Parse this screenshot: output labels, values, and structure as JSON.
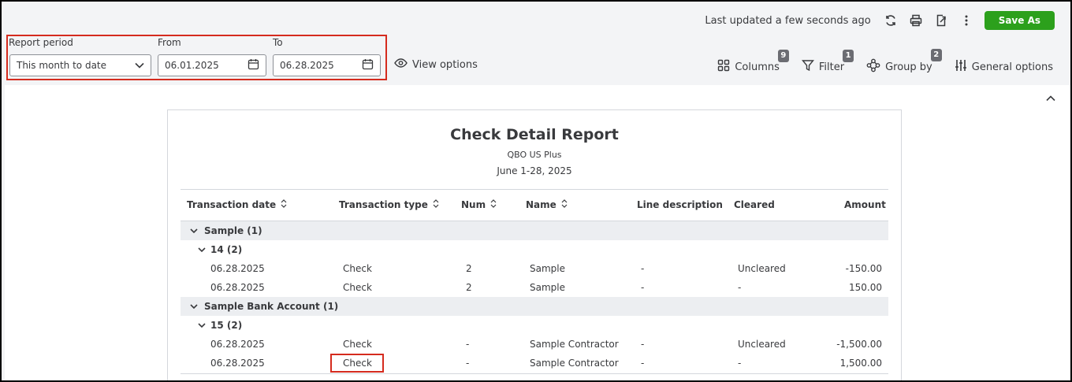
{
  "topbar": {
    "updated_text": "Last updated a few seconds ago",
    "save_as_label": "Save As"
  },
  "filters": {
    "report_period_label": "Report period",
    "report_period_value": "This month to date",
    "from_label": "From",
    "from_value": "06.01.2025",
    "to_label": "To",
    "to_value": "06.28.2025",
    "view_options_label": "View options"
  },
  "tools": [
    {
      "label": "Columns",
      "badge": "9",
      "icon": "columns-icon"
    },
    {
      "label": "Filter",
      "badge": "1",
      "icon": "filter-icon"
    },
    {
      "label": "Group by",
      "badge": "2",
      "icon": "group-by-icon"
    },
    {
      "label": "General options",
      "badge": "",
      "icon": "sliders-icon"
    }
  ],
  "report": {
    "title": "Check Detail Report",
    "company": "QBO US Plus",
    "period": "June 1-28, 2025",
    "columns": [
      "Transaction date",
      "Transaction type",
      "Num",
      "Name",
      "Line description",
      "Cleared",
      "Amount"
    ],
    "groups": [
      {
        "label": "Sample (1)",
        "subgroups": [
          {
            "label": "14 (2)",
            "rows": [
              {
                "date": "06.28.2025",
                "type": "Check",
                "num": "2",
                "name": "Sample",
                "desc": "-",
                "cleared": "Uncleared",
                "amount": "-150.00"
              },
              {
                "date": "06.28.2025",
                "type": "Check",
                "num": "2",
                "name": "Sample",
                "desc": "-",
                "cleared": "-",
                "amount": "150.00"
              }
            ]
          }
        ]
      },
      {
        "label": "Sample Bank Account (1)",
        "subgroups": [
          {
            "label": "15 (2)",
            "rows": [
              {
                "date": "06.28.2025",
                "type": "Check",
                "num": "-",
                "name": "Sample Contractor",
                "desc": "-",
                "cleared": "Uncleared",
                "amount": "-1,500.00"
              },
              {
                "date": "06.28.2025",
                "type": "Check",
                "num": "-",
                "name": "Sample Contractor",
                "desc": "-",
                "cleared": "-",
                "amount": "1,500.00"
              }
            ]
          }
        ]
      }
    ]
  },
  "colors": {
    "accent": "#2ca01c",
    "highlight": "#d52b1e",
    "group_bg": "#eceef1"
  }
}
